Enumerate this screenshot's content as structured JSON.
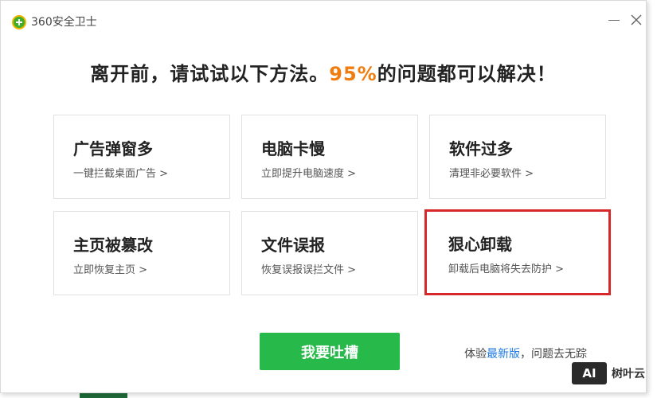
{
  "window": {
    "title": "360安全卫士"
  },
  "headline": {
    "before": "离开前，请试试以下方法。",
    "percent": "95%",
    "after": "的问题都可以解决！"
  },
  "cards": [
    {
      "title": "广告弹窗多",
      "subtitle": "一键拦截桌面广告 >"
    },
    {
      "title": "电脑卡慢",
      "subtitle": "立即提升电脑速度 >"
    },
    {
      "title": "软件过多",
      "subtitle": "清理非必要软件 >"
    },
    {
      "title": "主页被篡改",
      "subtitle": "立即恢复主页 >"
    },
    {
      "title": "文件误报",
      "subtitle": "恢复误报误拦文件 >"
    },
    {
      "title": "狠心卸载",
      "subtitle": "卸载后电脑将失去防护 >"
    }
  ],
  "feedback_button": "我要吐槽",
  "footer": {
    "prefix": "体验",
    "link": "最新版",
    "suffix": "，问题去无踪"
  },
  "watermark": {
    "badge": "AI",
    "text": "树叶云"
  },
  "colors": {
    "accent_orange": "#ef7d10",
    "button_green": "#27b94a",
    "highlight_red": "#d62828",
    "link_blue": "#1e7be0"
  }
}
